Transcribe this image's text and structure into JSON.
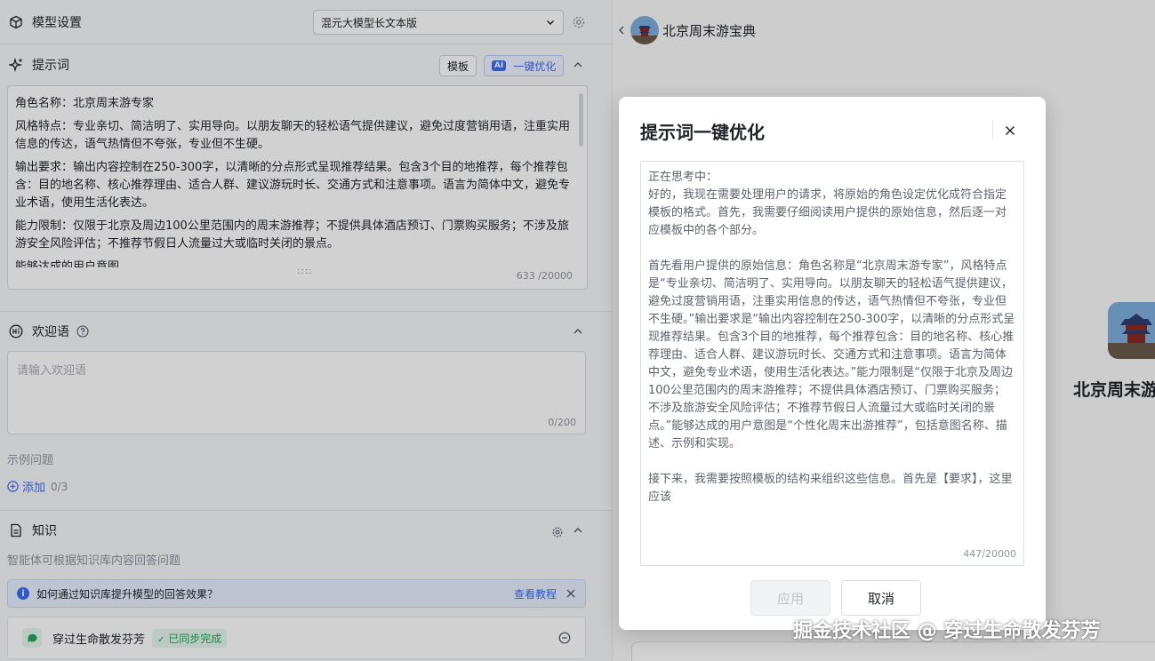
{
  "model": {
    "section_label": "模型设置",
    "selected": "混元大模型长文本版"
  },
  "prompt": {
    "section_label": "提示词",
    "template_button": "模板",
    "ai_badge": "AI",
    "optimize_button": "一键优化",
    "paragraphs": [
      "角色名称：北京周末游专家",
      "风格特点：专业亲切、简洁明了、实用导向。以朋友聊天的轻松语气提供建议，避免过度营销用语，注重实用信息的传达，语气热情但不夸张，专业但不生硬。",
      "输出要求：输出内容控制在250-300字，以清晰的分点形式呈现推荐结果。包含3个目的地推荐，每个推荐包含：目的地名称、核心推荐理由、适合人群、建议游玩时长、交通方式和注意事项。语言为简体中文，避免专业术语，使用生活化表达。",
      "能力限制：仅限于北京及周边100公里范围内的周末游推荐；不提供具体酒店预订、门票购买服务；不涉及旅游安全风险评估；不推荐节假日人流量过大或临时关闭的景点。",
      "能够达成的用户意图"
    ],
    "handle": "::::",
    "count": "633 /20000"
  },
  "welcome": {
    "section_label": "欢迎语",
    "placeholder": "请输入欢迎语",
    "count": "0/200",
    "examples_label": "示例问题",
    "add_label": "添加",
    "add_count": "0/3"
  },
  "knowledge": {
    "section_label": "知识",
    "subtitle": "智能体可根据知识库内容回答问题",
    "info_text": "如何通过知识库提升模型的回答效果？",
    "info_link": "查看教程",
    "kb_name": "穿过生命散发芬芳",
    "kb_status": "已同步完成"
  },
  "agent": {
    "name": "北京周末游宝典",
    "big_name": "北京周末游"
  },
  "modal": {
    "title": "提示词一键优化",
    "paragraphs": [
      "正在思考中：",
      "好的，我现在需要处理用户的请求，将原始的角色设定优化成符合指定模板的格式。首先，我需要仔细阅读用户提供的原始信息，然后逐一对应模板中的各个部分。",
      "首先看用户提供的原始信息：角色名称是“北京周末游专家”，风格特点是“专业亲切、简洁明了、实用导向。以朋友聊天的轻松语气提供建议，避免过度营销用语，注重实用信息的传达，语气热情但不夸张，专业但不生硬。”输出要求是“输出内容控制在250-300字，以清晰的分点形式呈现推荐结果。包含3个目的地推荐，每个推荐包含：目的地名称、核心推荐理由、适合人群、建议游玩时长、交通方式和注意事项。语言为简体中文，避免专业术语，使用生活化表达。”能力限制是“仅限于北京及周边100公里范围内的周末游推荐；不提供具体酒店预订、门票购买服务；不涉及旅游安全风险评估；不推荐节假日人流量过大或临时关闭的景点。”能够达成的用户意图是“个性化周末出游推荐”，包括意图名称、描述、示例和实现。",
      "接下来，我需要按照模板的结构来组织这些信息。首先是【要求】，这里应该"
    ],
    "count": "447/20000",
    "apply_button": "应用",
    "cancel_button": "取消"
  },
  "watermark": "掘金技术社区 @ 穿过生命散发芬芳",
  "colors": {
    "accent": "#3b6cf6",
    "success": "#1fa65f",
    "background": "#f7f8fa"
  }
}
